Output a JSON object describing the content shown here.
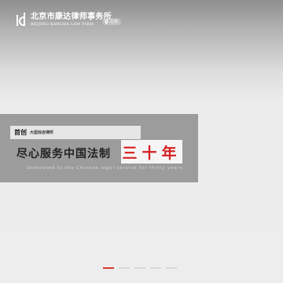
{
  "header": {
    "logo_cn": "北京市康达律师事务所",
    "logo_en": "BEIJING KANGDA LAW FIRM",
    "location_label": "北京"
  },
  "banner": {
    "tag_main": "首创",
    "tag_sub": "大型综合律所",
    "title": "尽心服务中国法制",
    "highlight": "三十年",
    "subtitle": "Dedicated to the Chinese legal service for thirty years"
  },
  "pager": {
    "count": 5,
    "active_index": 0
  },
  "colors": {
    "accent": "#d63a2f",
    "highlight_text": "#d41f1f"
  }
}
